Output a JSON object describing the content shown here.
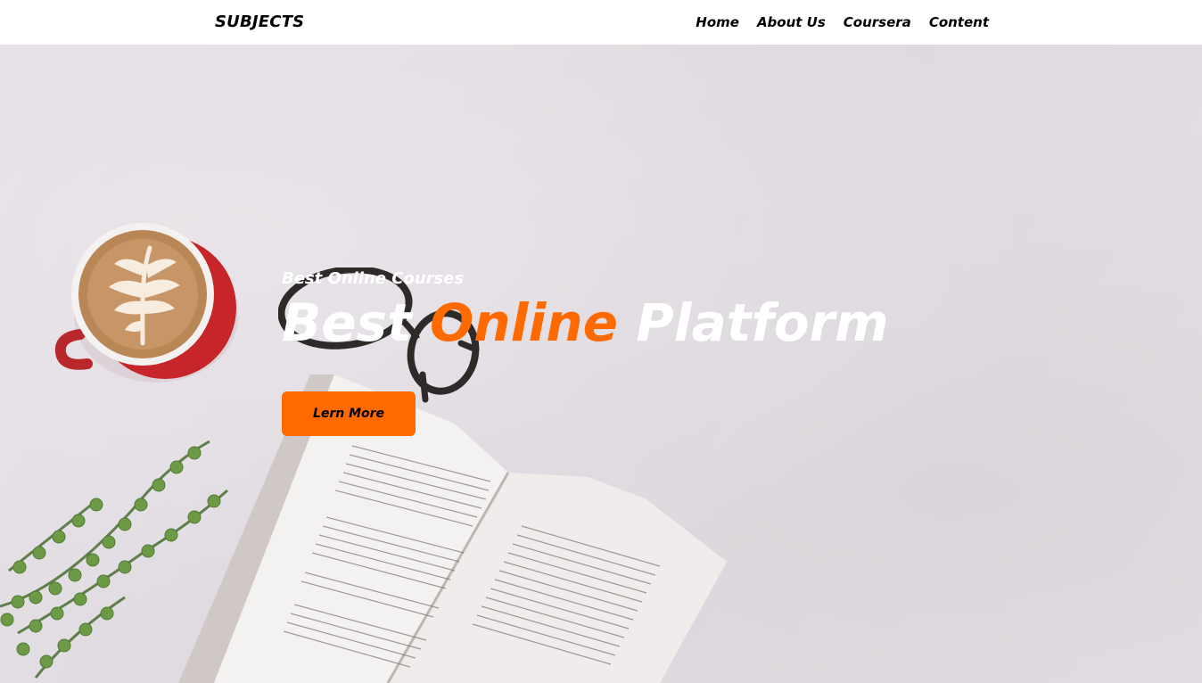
{
  "nav": {
    "logo": "SUBJECTS",
    "links": [
      "Home",
      "About Us",
      "Coursera",
      "Content"
    ]
  },
  "hero": {
    "subtitle": "Best Online Courses",
    "headline": {
      "word1": "Best",
      "word2": "Online",
      "word3": "Platform"
    },
    "cta_label": "Lern More"
  },
  "colors": {
    "accent": "#ff6a00",
    "nav_bg": "#ffffff",
    "hero_bg": "#dcd8dd"
  }
}
